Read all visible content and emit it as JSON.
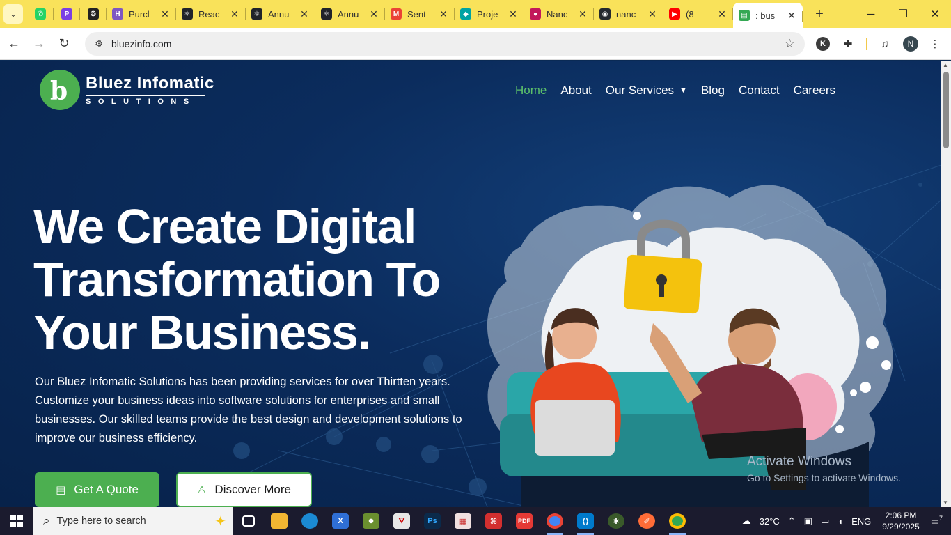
{
  "browser": {
    "tabs": [
      {
        "title": "",
        "color": "#25D366",
        "glyph": "✆"
      },
      {
        "title": "",
        "color": "#7b3fe4",
        "glyph": "P"
      },
      {
        "title": "",
        "color": "#222222",
        "glyph": "❂"
      },
      {
        "title": "Purcl",
        "color": "#7e57c2",
        "glyph": "H"
      },
      {
        "title": "Reac",
        "color": "#20232a",
        "glyph": "⚛"
      },
      {
        "title": "Annu",
        "color": "#20232a",
        "glyph": "⚛"
      },
      {
        "title": "Annu",
        "color": "#20232a",
        "glyph": "⚛"
      },
      {
        "title": "Sent",
        "color": "#ea4335",
        "glyph": "M"
      },
      {
        "title": "Proje",
        "color": "#00a3a3",
        "glyph": "◆"
      },
      {
        "title": "Nanc",
        "color": "#c2185b",
        "glyph": "●"
      },
      {
        "title": "nanc",
        "color": "#24292e",
        "glyph": "◉"
      },
      {
        "title": "(8",
        "color": "#ff0000",
        "glyph": "▶"
      },
      {
        "title": ": bus",
        "color": "#34a853",
        "glyph": "▤"
      }
    ],
    "url": "bluezinfo.com",
    "profile_k": "K",
    "profile_n": "N"
  },
  "site": {
    "logo_name": "Bluez Infomatic",
    "logo_sub": "SOLUTIONS",
    "nav": {
      "home": "Home",
      "about": "About",
      "services": "Our Services",
      "blog": "Blog",
      "contact": "Contact",
      "careers": "Careers"
    },
    "hero_title": "We Create Digital Transformation To Your Business.",
    "hero_desc": "Our Bluez Infomatic Solutions has been providing services for over Thirtten years. Customize your business ideas into software solutions for enterprises and small businesses. Our skilled teams provide the best design and development solutions to improve our business efficiency.",
    "btn_quote": "Get A Quote",
    "btn_discover": "Discover More"
  },
  "watermark": {
    "line1": "Activate Windows",
    "line2": "Go to Settings to activate Windows."
  },
  "taskbar": {
    "search_placeholder": "Type here to search",
    "weather_temp": "32°C",
    "language": "ENG",
    "time": "2:06 PM",
    "date": "9/29/2025",
    "notification_count": "7"
  },
  "colors": {
    "accent_green": "#4caf50",
    "nav_active": "#5cc16a",
    "tabstrip": "#f9e25a",
    "page_bg": "#0b2c5d"
  }
}
